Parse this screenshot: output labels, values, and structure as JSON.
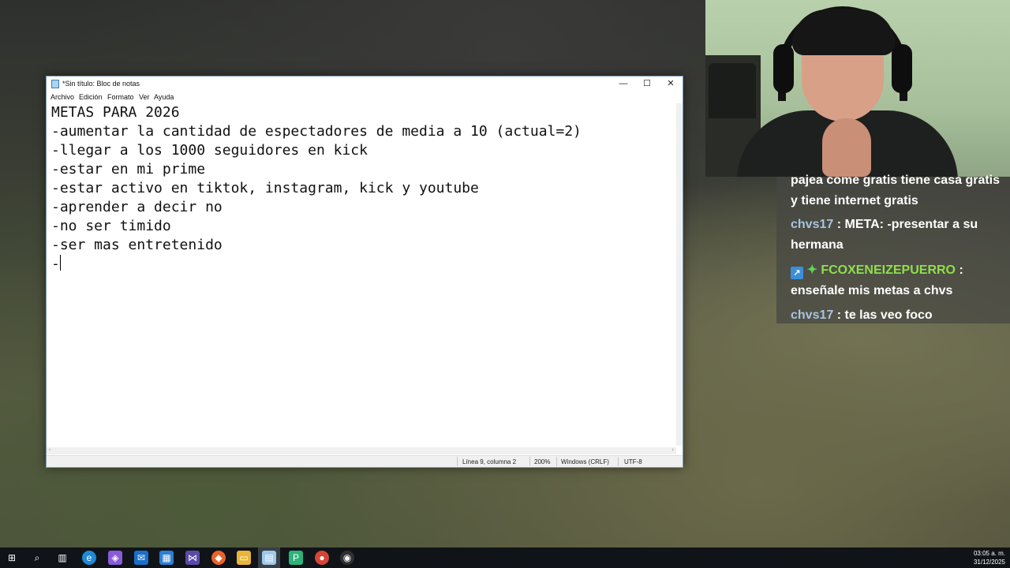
{
  "notepad": {
    "title": "*Sin título: Bloc de notas",
    "menu": [
      "Archivo",
      "Edición",
      "Formato",
      "Ver",
      "Ayuda"
    ],
    "lines": [
      "METAS PARA 2026",
      "-aumentar la cantidad de espectadores de media a 10 (actual=2)",
      "-llegar a los 1000 seguidores en kick",
      "-estar en mi prime",
      "-estar activo en tiktok, instagram, kick y youtube",
      "-aprender a decir no",
      "-no ser timido",
      "-ser mas entretenido",
      "-"
    ],
    "status": {
      "position": "Línea 9, columna 2",
      "zoom": "200%",
      "line_ending": "Windows (CRLF)",
      "encoding": "UTF-8"
    },
    "buttons": {
      "minimize": "—",
      "maximize": "☐",
      "close": "✕"
    }
  },
  "chat": {
    "messages": [
      {
        "user": "",
        "text": "pajea come gratis tiene casa gratis"
      },
      {
        "user": "",
        "text": "y tiene internet gratis"
      },
      {
        "user": "chvs17",
        "text": " : META: -presentar a su"
      },
      {
        "user": "",
        "text": "hermana"
      },
      {
        "user": "FCOXENEIZEPUERRO",
        "text": " :"
      },
      {
        "user": "",
        "text": "enseñale mis metas a chvs"
      },
      {
        "user": "chvs17",
        "text": " : te las veo foco"
      }
    ]
  },
  "taskbar": {
    "time": "03:05 a. m.",
    "date": "31/12/2025",
    "icons": [
      "windows-start",
      "search",
      "task-view",
      "edge",
      "copilot",
      "mail",
      "store",
      "visual-studio",
      "brave",
      "file-explorer",
      "notepad",
      "app-p",
      "chrome",
      "obs"
    ]
  }
}
